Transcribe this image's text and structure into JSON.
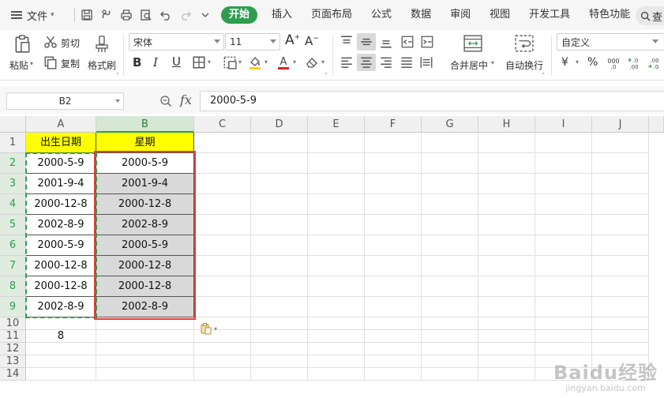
{
  "menubar": {
    "file_label": "文件",
    "tabs": [
      "开始",
      "插入",
      "页面布局",
      "公式",
      "数据",
      "审阅",
      "视图",
      "开发工具",
      "特色功能"
    ],
    "search_label": "查"
  },
  "ribbon": {
    "paste_label": "粘贴",
    "cut_label": "剪切",
    "copy_label": "复制",
    "format_painter_label": "格式刷",
    "font_name": "宋体",
    "font_size": "11",
    "bold": "B",
    "italic": "I",
    "underline": "U",
    "merge_label": "合并居中",
    "wrap_label": "自动换行",
    "number_format": "自定义",
    "currency_symbol": "¥",
    "percent_symbol": "%"
  },
  "formula_bar": {
    "cell_ref": "B2",
    "fx": "fx",
    "value": "2000-5-9"
  },
  "grid": {
    "columns": [
      "A",
      "B",
      "C",
      "D",
      "E",
      "F",
      "G",
      "H",
      "I",
      "J"
    ],
    "rows": [
      "1",
      "2",
      "3",
      "4",
      "5",
      "6",
      "7",
      "8",
      "9",
      "10",
      "11",
      "12",
      "13",
      "14"
    ],
    "header_a": "出生日期",
    "header_b": "星期",
    "col_a": [
      "2000-5-9",
      "2001-9-4",
      "2000-12-8",
      "2002-8-9",
      "2000-5-9",
      "2000-12-8",
      "2000-12-8",
      "2002-8-9"
    ],
    "col_b": [
      "2000-5-9",
      "2001-9-4",
      "2000-12-8",
      "2002-8-9",
      "2000-5-9",
      "2000-12-8",
      "2000-12-8",
      "2002-8-9"
    ],
    "a11": "8"
  },
  "watermark": {
    "brand": "Baidu经验",
    "url": "jingyan.baidu.com"
  },
  "colors": {
    "accent": "#2e9d4e",
    "header_fill": "#ffff00",
    "selection_fill": "#d9d9d9",
    "annotation": "#e0403a"
  }
}
